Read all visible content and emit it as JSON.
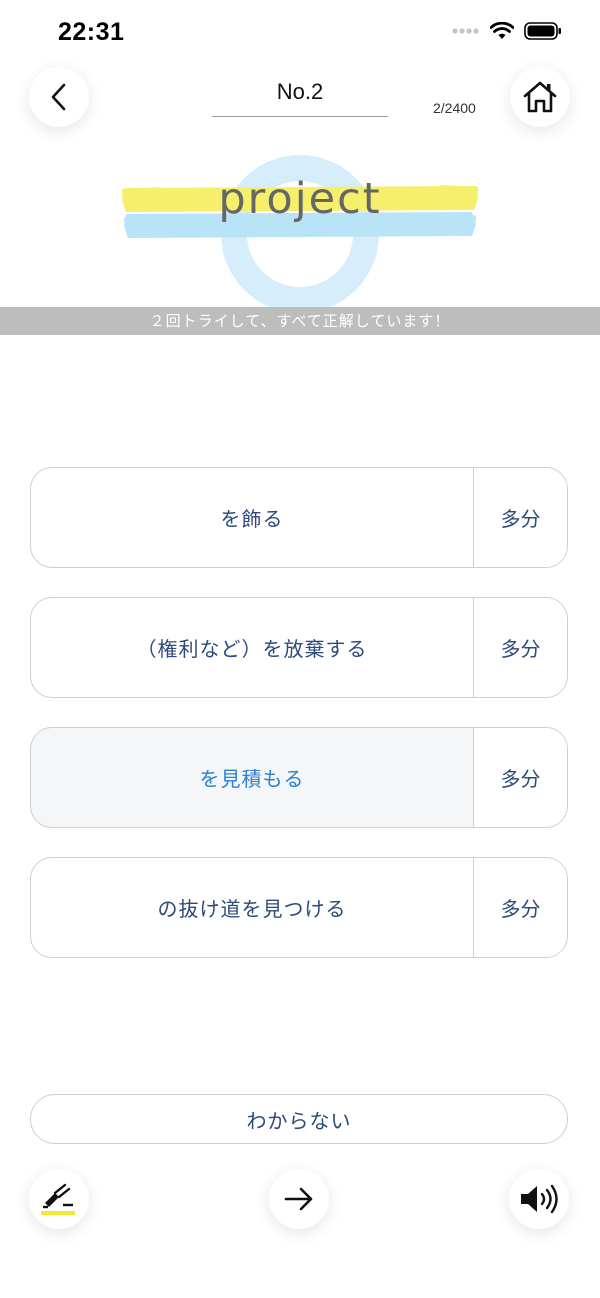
{
  "status_bar": {
    "time": "22:31"
  },
  "header": {
    "title": "No.2",
    "progress": "2/2400"
  },
  "word": {
    "text": "project"
  },
  "info": {
    "message": "２回トライして、すべて正解しています！"
  },
  "choices": [
    {
      "label": "を飾る",
      "maybe_label": "多分",
      "selected": false
    },
    {
      "label": "（権利など）を放棄する",
      "maybe_label": "多分",
      "selected": false
    },
    {
      "label": "を見積もる",
      "maybe_label": "多分",
      "selected": true
    },
    {
      "label": "の抜け道を見つける",
      "maybe_label": "多分",
      "selected": false
    }
  ],
  "dont_know_label": "わからない",
  "icons": {
    "back": "chevron-left-icon",
    "home": "home-icon",
    "marker": "highlighter-icon",
    "next": "arrow-right-icon",
    "sound": "speaker-icon"
  },
  "colors": {
    "accent_blue": "#2a7fd4",
    "text_navy": "#2d4a7a",
    "highlight_yellow": "#f5ec5a",
    "highlight_blue": "#b9e3f7",
    "strip_gray": "#bdbdbd"
  }
}
